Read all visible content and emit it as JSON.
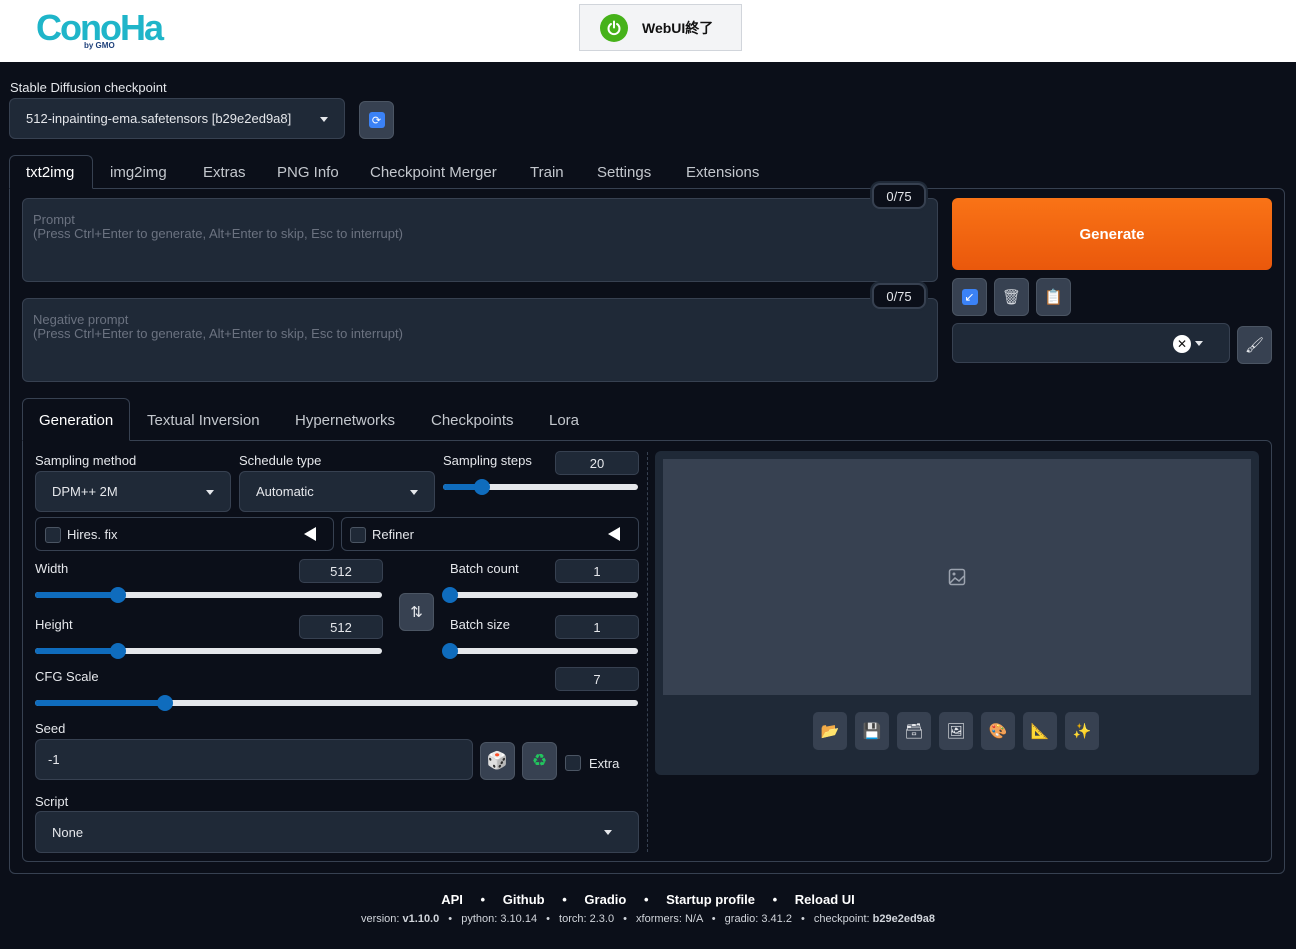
{
  "header": {
    "shutdown_label": "WebUI終了"
  },
  "checkpoint": {
    "label": "Stable Diffusion checkpoint",
    "value": "512-inpainting-ema.safetensors [b29e2ed9a8]"
  },
  "tabs": [
    "txt2img",
    "img2img",
    "Extras",
    "PNG Info",
    "Checkpoint Merger",
    "Train",
    "Settings",
    "Extensions"
  ],
  "prompt": {
    "placeholder_title": "Prompt",
    "placeholder_hint": "(Press Ctrl+Enter to generate, Alt+Enter to skip, Esc to interrupt)",
    "counter": "0/75"
  },
  "negative_prompt": {
    "placeholder_title": "Negative prompt",
    "placeholder_hint": "(Press Ctrl+Enter to generate, Alt+Enter to skip, Esc to interrupt)",
    "counter": "0/75"
  },
  "generate_label": "Generate",
  "subtabs": [
    "Generation",
    "Textual Inversion",
    "Hypernetworks",
    "Checkpoints",
    "Lora"
  ],
  "sampling_method": {
    "label": "Sampling method",
    "value": "DPM++ 2M"
  },
  "schedule_type": {
    "label": "Schedule type",
    "value": "Automatic"
  },
  "sampling_steps": {
    "label": "Sampling steps",
    "value": "20",
    "fraction": 0.2
  },
  "hires_fix": {
    "label": "Hires. fix"
  },
  "refiner": {
    "label": "Refiner"
  },
  "width": {
    "label": "Width",
    "value": "512",
    "fraction": 0.24
  },
  "height": {
    "label": "Height",
    "value": "512",
    "fraction": 0.24
  },
  "batch_count": {
    "label": "Batch count",
    "value": "1",
    "fraction": 0.0
  },
  "batch_size": {
    "label": "Batch size",
    "value": "1",
    "fraction": 0.0
  },
  "cfg_scale": {
    "label": "CFG Scale",
    "value": "7",
    "fraction": 0.216
  },
  "seed": {
    "label": "Seed",
    "value": "-1",
    "extra_label": "Extra"
  },
  "script": {
    "label": "Script",
    "value": "None"
  },
  "footer": {
    "links": [
      "API",
      "Github",
      "Gradio",
      "Startup profile",
      "Reload UI"
    ],
    "version": "v1.10.0",
    "python": "3.10.14",
    "torch": "2.3.0",
    "xformers": "N/A",
    "gradio": "3.41.2",
    "checkpoint": "b29e2ed9a8"
  },
  "colors": {
    "accent": "#f97316",
    "slider": "#0f6cbd",
    "background": "#0b0f19"
  }
}
